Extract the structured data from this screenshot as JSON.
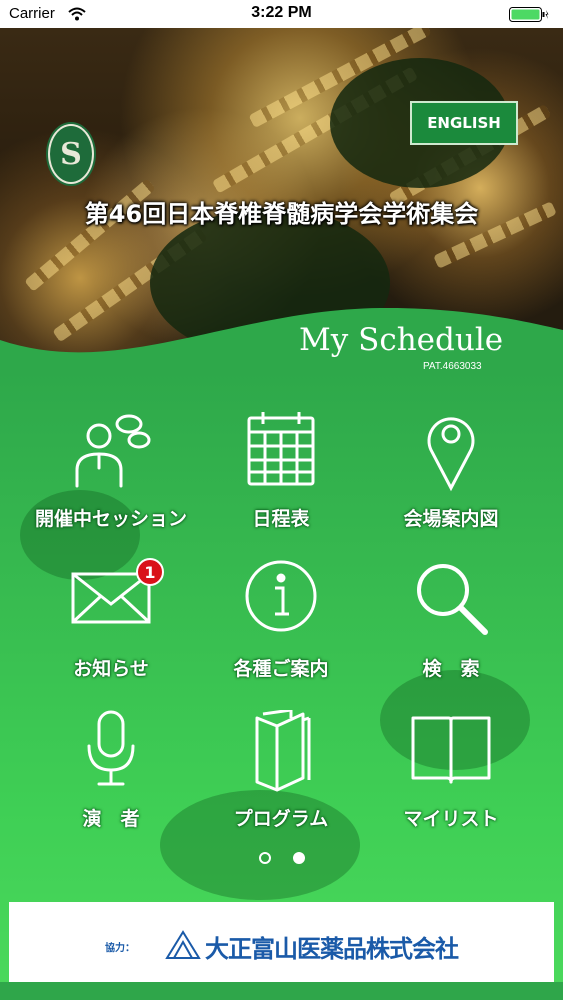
{
  "status_bar": {
    "carrier": "Carrier",
    "time": "3:22 PM"
  },
  "header": {
    "logo_letter": "S",
    "english_button": "ENGLISH",
    "conference_title": "第46回日本脊椎脊髄病学会学術集会"
  },
  "schedule": {
    "title": "My Schedule",
    "patent": "PAT.4663033"
  },
  "menu": [
    {
      "label": "開催中セッション",
      "icon": "sessions-icon"
    },
    {
      "label": "日程表",
      "icon": "calendar-icon"
    },
    {
      "label": "会場案内図",
      "icon": "map-pin-icon"
    },
    {
      "label": "お知らせ",
      "icon": "mail-icon",
      "badge": "1"
    },
    {
      "label": "各種ご案内",
      "icon": "info-icon"
    },
    {
      "label": "検　索",
      "icon": "search-icon"
    },
    {
      "label": "演　者",
      "icon": "microphone-icon"
    },
    {
      "label": "プログラム",
      "icon": "program-book-icon"
    },
    {
      "label": "マイリスト",
      "icon": "my-list-book-icon"
    }
  ],
  "pager": {
    "pages": 2,
    "current": 2
  },
  "sponsor": {
    "label": "協力：",
    "name": "大正富山医薬品株式会社"
  },
  "colors": {
    "green": "#36b84f",
    "english_bg": "#1b8a3c",
    "badge": "#d9121a",
    "sponsor_blue": "#1a5aa8"
  }
}
